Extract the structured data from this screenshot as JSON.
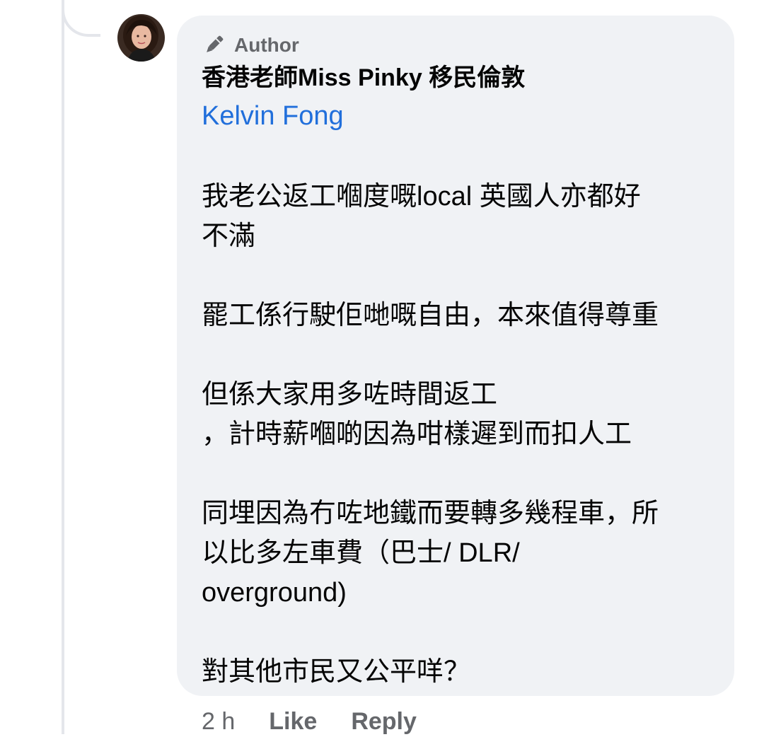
{
  "comment": {
    "badge": "Author",
    "author_name": "香港老師Miss Pinky 移民倫敦",
    "mention": "Kelvin Fong",
    "paragraphs": [
      [
        "我老公返工嗰度嘅local 英國人亦都好",
        "不滿"
      ],
      [
        "罷工係行駛佢哋嘅自由，本來值得尊重"
      ],
      [
        "但係大家用多咗時間返工",
        "，計時薪嗰啲因為咁樣遲到而扣人工"
      ],
      [
        "同埋因為冇咗地鐵而要轉多幾程車，所",
        "以比多左車費（巴士/ DLR/",
        "overground)"
      ],
      [
        "對其他市民又公平咩？"
      ]
    ]
  },
  "actions": {
    "time": "2 h",
    "like": "Like",
    "reply": "Reply"
  },
  "colors": {
    "bubble": "#f0f2f5",
    "mention": "#216fdb",
    "secondary_text": "#65676b",
    "primary_text": "#050505"
  },
  "icons": {
    "badge_icon": "pen-icon"
  }
}
